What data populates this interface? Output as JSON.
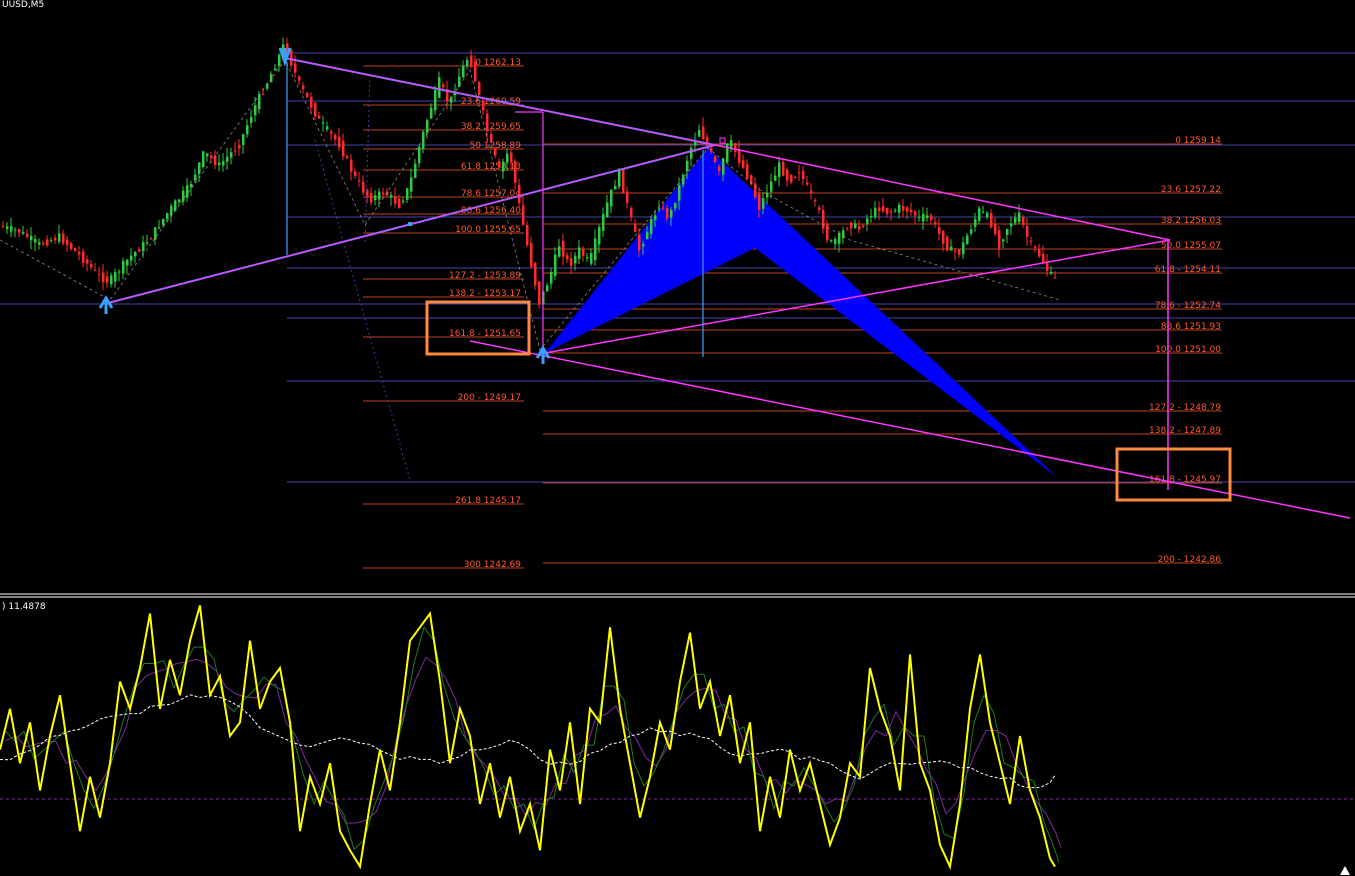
{
  "header": {
    "symbol_label": "UUSD,M5"
  },
  "oscillator": {
    "value_label": ") 11.4878"
  },
  "colors": {
    "background": "#000000",
    "bull_candle": "#2ecc40",
    "bear_candle": "#ff2a2a",
    "fib_line": "#ff5a2a",
    "fib_text": "#ff5a2a",
    "grid_blue": "#5a5ae6",
    "pattern_fill": "#0000ff",
    "magenta": "#ff33ff",
    "cyan": "#3aa0ff",
    "orange_box": "#ff8a3c",
    "osc_yellow": "#ffff00",
    "osc_green": "#1e7d1e",
    "osc_purple": "#7d2a9b",
    "osc_white": "#ffffff"
  },
  "fib_left": [
    {
      "label": "0 1262.13"
    },
    {
      "label": "23.6 1260.59"
    },
    {
      "label": "38.2 1259.65"
    },
    {
      "label": "50 1258.89"
    },
    {
      "label": "61.8 1258.13"
    },
    {
      "label": "78.6 1257.04"
    },
    {
      "label": "88.6 1256.40"
    },
    {
      "label": "100.0 1255.65"
    },
    {
      "label": "127.2 - 1253.89"
    },
    {
      "label": "138.2 - 1253.17"
    },
    {
      "label": "161.8 - 1251.65"
    },
    {
      "label": "200 - 1249.17"
    },
    {
      "label": "261.8 1245.17"
    },
    {
      "label": "300 1242.69"
    }
  ],
  "fib_right": [
    {
      "label": "0 1259.14"
    },
    {
      "label": "23.6 1257.22"
    },
    {
      "label": "38.2 1256.03"
    },
    {
      "label": "50.0 1255.07"
    },
    {
      "label": "61.8 - 1254.11"
    },
    {
      "label": "78.6 - 1252.74"
    },
    {
      "label": "88.6 1251.93"
    },
    {
      "label": "100.0 1251.00"
    },
    {
      "label": "127.2 - 1248.79"
    },
    {
      "label": "138.2 - 1247.89"
    },
    {
      "label": "161.8 - 1245.97"
    },
    {
      "label": "200 - 1242.86"
    }
  ],
  "chart_data": {
    "type": "candlestick",
    "title": "UUSD,M5",
    "ylim": [
      1241.5,
      1263.5
    ],
    "oscillator_ylim": [
      0,
      100
    ],
    "price_path": [
      [
        0,
        1255.3
      ],
      [
        20,
        1255.1
      ],
      [
        40,
        1254.6
      ],
      [
        60,
        1254.9
      ],
      [
        80,
        1254.2
      ],
      [
        100,
        1253.4
      ],
      [
        110,
        1253.2
      ],
      [
        130,
        1254.1
      ],
      [
        150,
        1254.8
      ],
      [
        170,
        1255.9
      ],
      [
        190,
        1256.8
      ],
      [
        205,
        1258.1
      ],
      [
        220,
        1257.6
      ],
      [
        240,
        1258.4
      ],
      [
        255,
        1259.8
      ],
      [
        270,
        1260.9
      ],
      [
        285,
        1262.2
      ],
      [
        300,
        1260.7
      ],
      [
        320,
        1259.3
      ],
      [
        340,
        1258.4
      ],
      [
        355,
        1257.2
      ],
      [
        370,
        1256.3
      ],
      [
        385,
        1256.6
      ],
      [
        400,
        1256.1
      ],
      [
        410,
        1256.8
      ],
      [
        420,
        1258.3
      ],
      [
        430,
        1259.6
      ],
      [
        440,
        1260.8
      ],
      [
        450,
        1259.9
      ],
      [
        460,
        1261.0
      ],
      [
        470,
        1261.8
      ],
      [
        480,
        1260.2
      ],
      [
        490,
        1258.6
      ],
      [
        500,
        1257.4
      ],
      [
        510,
        1258.2
      ],
      [
        520,
        1256.1
      ],
      [
        530,
        1254.2
      ],
      [
        540,
        1252.4
      ],
      [
        550,
        1253.3
      ],
      [
        560,
        1254.6
      ],
      [
        570,
        1253.8
      ],
      [
        580,
        1254.4
      ],
      [
        590,
        1253.9
      ],
      [
        600,
        1255.2
      ],
      [
        610,
        1256.4
      ],
      [
        620,
        1257.3
      ],
      [
        630,
        1255.8
      ],
      [
        640,
        1254.4
      ],
      [
        650,
        1255.3
      ],
      [
        660,
        1256.1
      ],
      [
        670,
        1255.6
      ],
      [
        680,
        1256.8
      ],
      [
        690,
        1258.1
      ],
      [
        700,
        1259.0
      ],
      [
        710,
        1258.2
      ],
      [
        720,
        1257.3
      ],
      [
        730,
        1258.6
      ],
      [
        740,
        1257.8
      ],
      [
        750,
        1257.1
      ],
      [
        760,
        1256.0
      ],
      [
        770,
        1256.8
      ],
      [
        780,
        1257.6
      ],
      [
        790,
        1257.0
      ],
      [
        800,
        1257.4
      ],
      [
        810,
        1256.6
      ],
      [
        820,
        1255.8
      ],
      [
        830,
        1254.6
      ],
      [
        840,
        1254.9
      ],
      [
        850,
        1255.4
      ],
      [
        860,
        1255.2
      ],
      [
        870,
        1255.7
      ],
      [
        880,
        1256.0
      ],
      [
        890,
        1255.8
      ],
      [
        900,
        1256.0
      ],
      [
        910,
        1255.9
      ],
      [
        920,
        1255.6
      ],
      [
        930,
        1255.7
      ],
      [
        940,
        1255.0
      ],
      [
        950,
        1254.4
      ],
      [
        960,
        1254.3
      ],
      [
        970,
        1255.1
      ],
      [
        980,
        1255.9
      ],
      [
        990,
        1255.6
      ],
      [
        1000,
        1254.6
      ],
      [
        1010,
        1255.4
      ],
      [
        1020,
        1255.7
      ],
      [
        1030,
        1254.7
      ],
      [
        1040,
        1254.2
      ],
      [
        1050,
        1253.5
      ],
      [
        1058,
        1253.2
      ]
    ],
    "osc_path": [
      [
        0,
        45
      ],
      [
        10,
        60
      ],
      [
        20,
        40
      ],
      [
        30,
        55
      ],
      [
        40,
        30
      ],
      [
        50,
        50
      ],
      [
        60,
        65
      ],
      [
        70,
        40
      ],
      [
        80,
        15
      ],
      [
        90,
        35
      ],
      [
        100,
        20
      ],
      [
        110,
        40
      ],
      [
        120,
        70
      ],
      [
        130,
        60
      ],
      [
        140,
        75
      ],
      [
        150,
        95
      ],
      [
        160,
        60
      ],
      [
        170,
        78
      ],
      [
        180,
        65
      ],
      [
        190,
        85
      ],
      [
        200,
        98
      ],
      [
        210,
        65
      ],
      [
        220,
        72
      ],
      [
        230,
        50
      ],
      [
        240,
        55
      ],
      [
        250,
        85
      ],
      [
        260,
        60
      ],
      [
        270,
        70
      ],
      [
        280,
        75
      ],
      [
        290,
        55
      ],
      [
        300,
        15
      ],
      [
        310,
        35
      ],
      [
        320,
        25
      ],
      [
        330,
        40
      ],
      [
        340,
        15
      ],
      [
        350,
        8
      ],
      [
        360,
        2
      ],
      [
        370,
        25
      ],
      [
        380,
        45
      ],
      [
        390,
        30
      ],
      [
        400,
        55
      ],
      [
        410,
        85
      ],
      [
        420,
        90
      ],
      [
        430,
        95
      ],
      [
        440,
        70
      ],
      [
        450,
        40
      ],
      [
        460,
        60
      ],
      [
        470,
        50
      ],
      [
        480,
        25
      ],
      [
        490,
        40
      ],
      [
        500,
        20
      ],
      [
        510,
        35
      ],
      [
        520,
        15
      ],
      [
        530,
        25
      ],
      [
        540,
        8
      ],
      [
        550,
        45
      ],
      [
        560,
        30
      ],
      [
        570,
        55
      ],
      [
        580,
        25
      ],
      [
        590,
        60
      ],
      [
        600,
        55
      ],
      [
        610,
        90
      ],
      [
        620,
        60
      ],
      [
        630,
        40
      ],
      [
        640,
        20
      ],
      [
        650,
        35
      ],
      [
        660,
        55
      ],
      [
        670,
        45
      ],
      [
        680,
        70
      ],
      [
        690,
        88
      ],
      [
        700,
        60
      ],
      [
        710,
        70
      ],
      [
        720,
        50
      ],
      [
        730,
        65
      ],
      [
        740,
        40
      ],
      [
        750,
        55
      ],
      [
        760,
        15
      ],
      [
        770,
        35
      ],
      [
        780,
        20
      ],
      [
        790,
        45
      ],
      [
        800,
        30
      ],
      [
        810,
        40
      ],
      [
        820,
        25
      ],
      [
        830,
        10
      ],
      [
        840,
        20
      ],
      [
        850,
        40
      ],
      [
        860,
        35
      ],
      [
        870,
        75
      ],
      [
        880,
        60
      ],
      [
        890,
        50
      ],
      [
        900,
        30
      ],
      [
        910,
        80
      ],
      [
        920,
        40
      ],
      [
        930,
        30
      ],
      [
        940,
        10
      ],
      [
        950,
        2
      ],
      [
        960,
        25
      ],
      [
        970,
        60
      ],
      [
        980,
        80
      ],
      [
        990,
        55
      ],
      [
        1000,
        40
      ],
      [
        1010,
        25
      ],
      [
        1020,
        50
      ],
      [
        1030,
        30
      ],
      [
        1040,
        20
      ],
      [
        1050,
        5
      ],
      [
        1055,
        2
      ]
    ]
  }
}
